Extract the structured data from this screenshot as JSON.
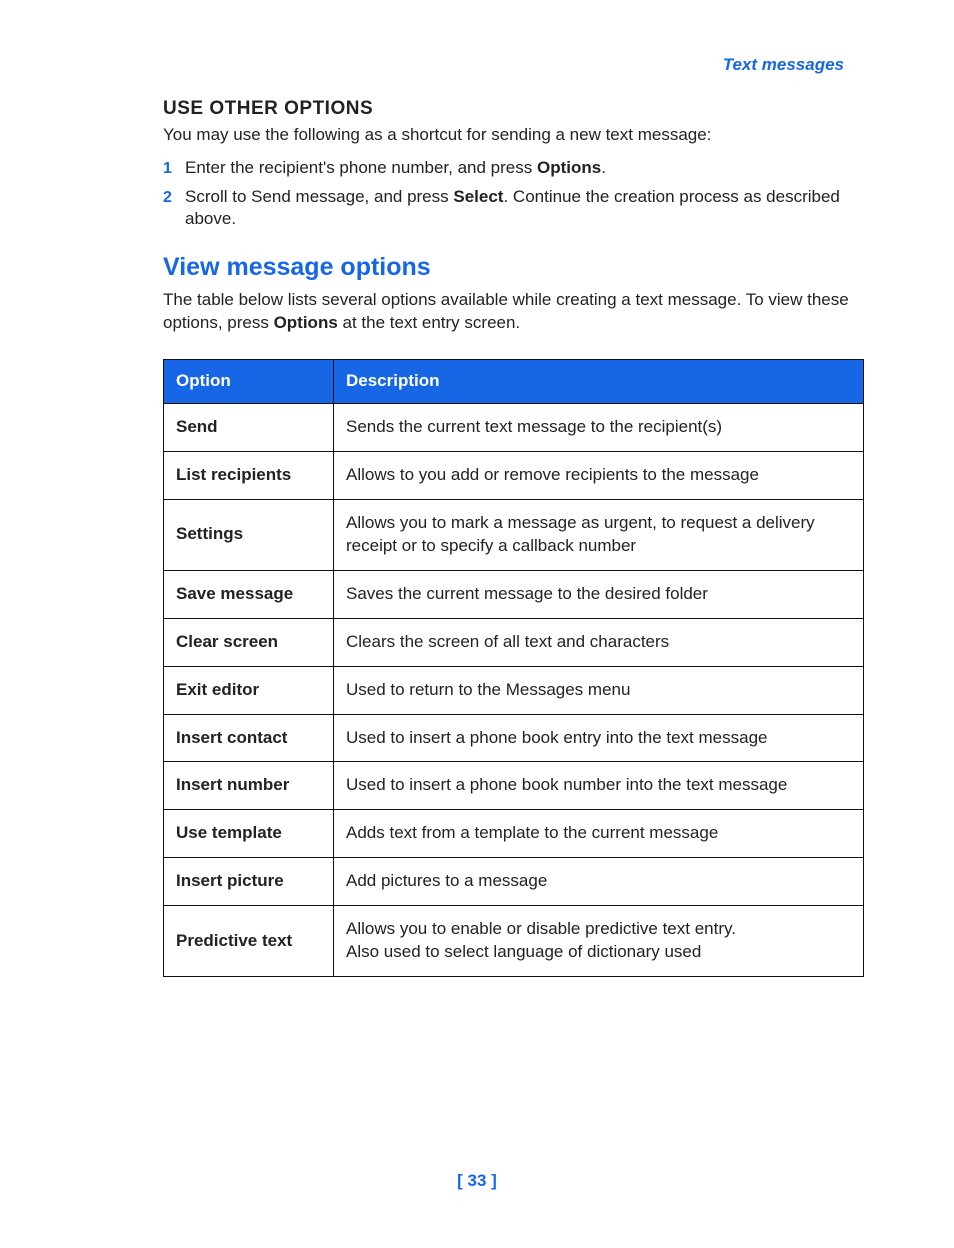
{
  "header": {
    "section_link": "Text messages"
  },
  "use_other_options": {
    "title": "USE OTHER OPTIONS",
    "intro": "You may use the following as a shortcut for sending a new text message:",
    "steps": {
      "0": {
        "pre": "Enter the recipient's phone number, and press ",
        "bold": "Options",
        "post": "."
      },
      "1": {
        "pre": "Scroll to Send message, and press ",
        "bold": "Select",
        "post": ". Continue the creation process as described above."
      }
    }
  },
  "view_message_options": {
    "title": "View message options",
    "desc_pre": "The table below lists several options available while creating a text message. To view these options, press ",
    "desc_bold": "Options",
    "desc_post": " at the text entry screen."
  },
  "table": {
    "head": {
      "option": "Option",
      "description": "Description"
    },
    "rows": {
      "0": {
        "option": "Send",
        "description": "Sends the current text message to the recipient(s)"
      },
      "1": {
        "option": "List recipients",
        "description": "Allows to you add or remove recipients to the message"
      },
      "2": {
        "option": "Settings",
        "description": "Allows you to mark a message as urgent, to request a delivery receipt or to specify a callback number"
      },
      "3": {
        "option": "Save message",
        "description": "Saves the current message to the desired folder"
      },
      "4": {
        "option": "Clear screen",
        "description": "Clears the screen of all text and characters"
      },
      "5": {
        "option": "Exit editor",
        "description": "Used to return to the Messages menu"
      },
      "6": {
        "option": "Insert contact",
        "description": "Used to insert a phone book entry into the text message"
      },
      "7": {
        "option": "Insert number",
        "description": "Used to insert a phone book number into the text message"
      },
      "8": {
        "option": "Use template",
        "description": "Adds text from a template to the current message"
      },
      "9": {
        "option": "Insert picture",
        "description": "Add pictures to a message"
      },
      "10": {
        "option": "Predictive text",
        "description": "Allows you to enable or disable predictive text entry.\nAlso used to select language of dictionary used"
      }
    }
  },
  "page_number": "[ 33 ]"
}
